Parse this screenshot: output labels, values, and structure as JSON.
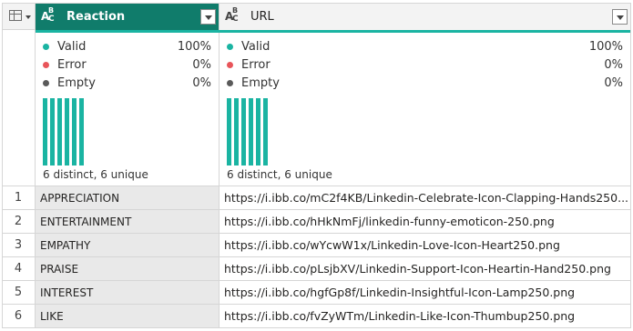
{
  "columns": [
    {
      "name": "Reaction",
      "type_icon": "text-type-icon",
      "selected": true
    },
    {
      "name": "URL",
      "type_icon": "text-type-icon",
      "selected": false
    }
  ],
  "profiles": [
    {
      "valid_label": "Valid",
      "valid_pct": "100%",
      "error_label": "Error",
      "error_pct": "0%",
      "empty_label": "Empty",
      "empty_pct": "0%",
      "distinct_text": "6 distinct, 6 unique",
      "bar_values": [
        1,
        1,
        1,
        1,
        1,
        1
      ]
    },
    {
      "valid_label": "Valid",
      "valid_pct": "100%",
      "error_label": "Error",
      "error_pct": "0%",
      "empty_label": "Empty",
      "empty_pct": "0%",
      "distinct_text": "6 distinct, 6 unique",
      "bar_values": [
        1,
        1,
        1,
        1,
        1,
        1
      ]
    }
  ],
  "rows": [
    {
      "num": "1",
      "reaction": "APPRECIATION",
      "url": "https://i.ibb.co/mC2f4KB/Linkedin-Celebrate-Icon-Clapping-Hands250..."
    },
    {
      "num": "2",
      "reaction": "ENTERTAINMENT",
      "url": "https://i.ibb.co/hHkNmFj/linkedin-funny-emoticon-250.png"
    },
    {
      "num": "3",
      "reaction": "EMPATHY",
      "url": "https://i.ibb.co/wYcwW1x/Linkedin-Love-Icon-Heart250.png"
    },
    {
      "num": "4",
      "reaction": "PRAISE",
      "url": "https://i.ibb.co/pLsjbXV/Linkedin-Support-Icon-Heartin-Hand250.png"
    },
    {
      "num": "5",
      "reaction": "INTEREST",
      "url": "https://i.ibb.co/hgfGp8f/Linkedin-Insightful-Icon-Lamp250.png"
    },
    {
      "num": "6",
      "reaction": "LIKE",
      "url": "https://i.ibb.co/fvZyWTm/Linkedin-Like-Icon-Thumbup250.png"
    }
  ],
  "colors": {
    "accent": "#107c6b",
    "valid": "#1ab4a2",
    "error": "#e8555a",
    "empty": "#5a5a5a"
  }
}
